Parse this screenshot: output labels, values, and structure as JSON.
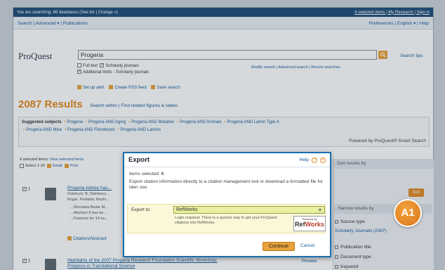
{
  "topbar": {
    "searching": "You are searching: 86 databases (See list | Change »)",
    "right": "4 selected items | My Research | Sign in"
  },
  "nav": {
    "left": "Search | Advanced ▾ | Publications",
    "right": "Preferences | English ▾ | Help"
  },
  "logo": "ProQuest",
  "search": {
    "query": "Progeria",
    "tips": "Search tips"
  },
  "options": {
    "fulltext": "Full text",
    "scholarly": "Scholarly journals",
    "additional": "Additional limits - Scholarly journals",
    "modify": "Modify search | Advanced search | Recent searches"
  },
  "alerts": [
    "Set up alert",
    "Create RSS feed",
    "Save search"
  ],
  "results": {
    "count": "2087 Results",
    "links": "Search within | Find related figures & tables"
  },
  "subjects": {
    "label": "Suggested subjects",
    "items": [
      "Progeria",
      "Progeria AND Aging",
      "Progeria AND Mutation",
      "Progeria AND Animals",
      "Progeria AND Lamin Type A",
      "Progeria AND Mice",
      "Progeria AND Fibroblasts",
      "Progeria AND Lamins"
    ],
    "powered": "Powered by ProQuest® Smart Search"
  },
  "selection": {
    "line1": "4 selected items:",
    "line1b": "View selected items",
    "select": "Select 1-20",
    "email": "Email",
    "print": "Print"
  },
  "right_panel": {
    "sort_by": "Sort results by",
    "sort_btn": "Sort",
    "narrow": "Narrow results by",
    "facets": [
      "Source type",
      "Scholarly Journals (2087)",
      "Publication title",
      "Document type",
      "Keyword"
    ]
  },
  "result1": {
    "num": "1",
    "title": "Progeria kidney has...",
    "authors": "Delahunt, B; Stehbens...",
    "author2": "Roger. Pediatric Nephr...",
    "line1": "...Shozawa Beate M...",
    "line2": "...Abstract It has be...",
    "line3": "...Features for 14 au...",
    "citation": "Citation/Abstract"
  },
  "result2": {
    "num": "2",
    "title": "Highlights of the 2007 Progeria Research Foundation Scientific Workshop:",
    "title2": "Progress in Translational Science",
    "preview": "Preview"
  },
  "dialog": {
    "title": "Export",
    "help": "Help",
    "items": "Items selected:",
    "items_count": "4",
    "desc": "Export citation information directly to a citation management tool or download a formatted file for later use.",
    "export_label": "Export to:",
    "export_value": "RefWorks",
    "note": "Login required. There is a quicker way to get your ProQuest citations into RefWorks.",
    "badge_top": "Powered by",
    "badge_ref": "Ref",
    "badge_works": "Works",
    "continue": "Continue",
    "cancel": "Cancel"
  },
  "badge": "A1"
}
